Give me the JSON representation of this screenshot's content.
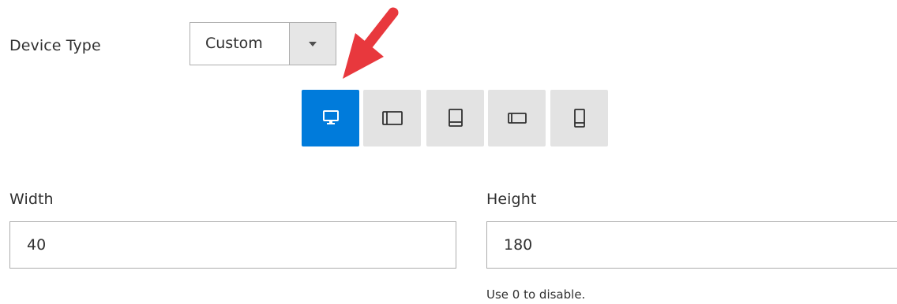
{
  "device_type": {
    "label": "Device Type",
    "selected": "Custom",
    "dropdown_icon": "caret-down-icon"
  },
  "device_buttons": [
    {
      "icon": "desktop-icon",
      "active": true
    },
    {
      "icon": "tablet-landscape-icon",
      "active": false
    },
    {
      "icon": "laptop-icon",
      "active": false
    },
    {
      "icon": "mobile-landscape-icon",
      "active": false
    },
    {
      "icon": "mobile-portrait-icon",
      "active": false
    }
  ],
  "width": {
    "label": "Width",
    "value": "40"
  },
  "height": {
    "label": "Height",
    "value": "180",
    "note": "Use 0 to disable."
  },
  "colors": {
    "active_button": "#007bdb",
    "inactive_button": "#e3e3e3",
    "annotation_arrow": "#e8383d",
    "text": "#303030",
    "border": "#adadad"
  }
}
